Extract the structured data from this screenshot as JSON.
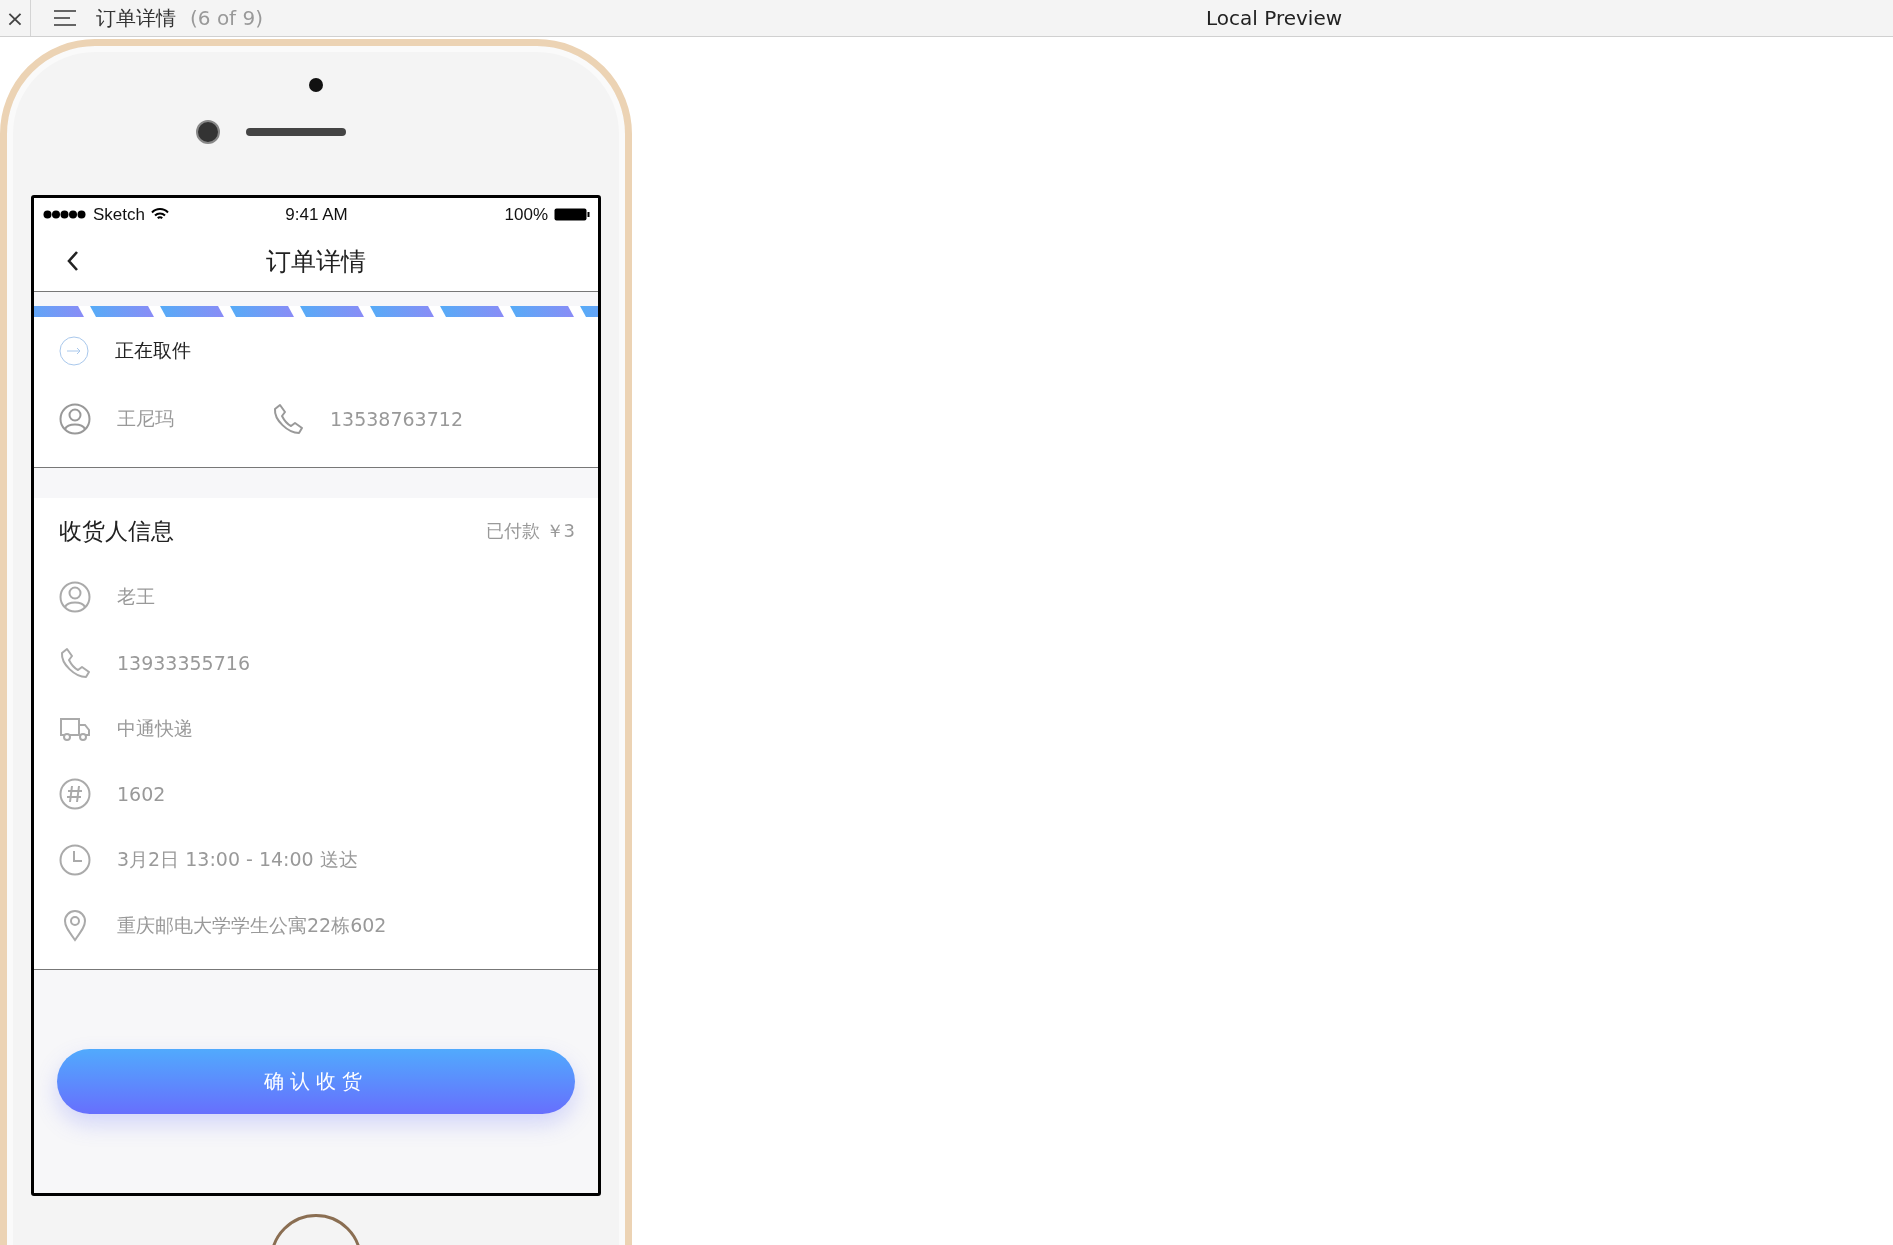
{
  "toolbar": {
    "close": "×",
    "title": "订单详情",
    "counter": "(6 of 9)",
    "preview_title": "Local Preview"
  },
  "status_bar": {
    "carrier": "Sketch",
    "time": "9:41 AM",
    "battery": "100%"
  },
  "nav": {
    "title": "订单详情"
  },
  "pickup": {
    "status": "正在取件",
    "courier_name": "王尼玛",
    "courier_phone": "13538763712"
  },
  "recipient": {
    "title": "收货人信息",
    "payment": "已付款 ￥3",
    "rows": [
      {
        "kind": "person",
        "text": "老王"
      },
      {
        "kind": "phone",
        "text": "13933355716"
      },
      {
        "kind": "truck",
        "text": "中通快递"
      },
      {
        "kind": "number",
        "text": "1602"
      },
      {
        "kind": "time",
        "text": "3月2日 13:00 - 14:00 送达"
      },
      {
        "kind": "location",
        "text": "重庆邮电大学学生公寓22栋602"
      }
    ]
  },
  "confirm_button": "确认收货"
}
